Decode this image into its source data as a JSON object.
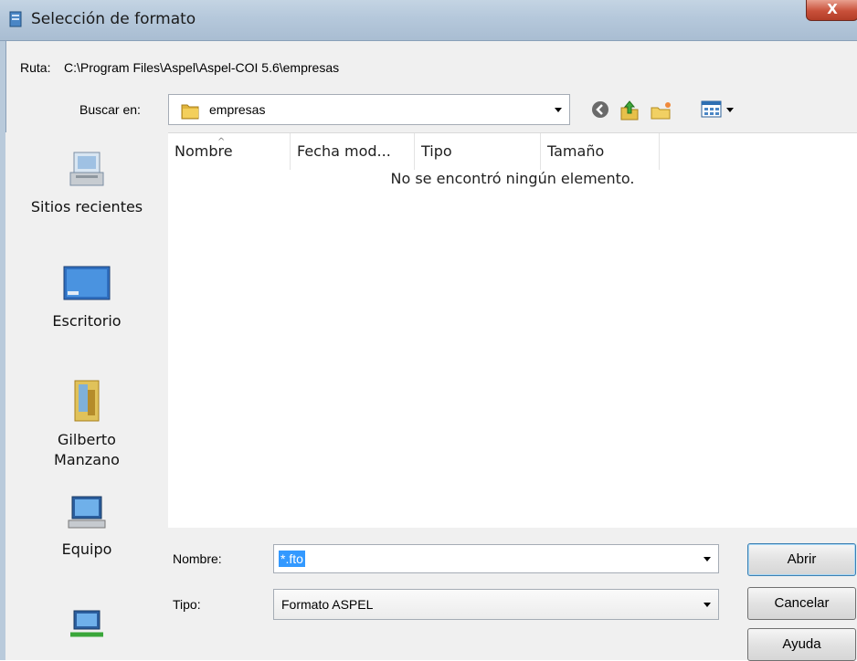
{
  "window": {
    "title": "Selección de formato",
    "close_glyph": "X"
  },
  "path": {
    "label": "Ruta:",
    "value": "C:\\Program Files\\Aspel\\Aspel-COI 5.6\\empresas"
  },
  "look_in": {
    "label": "Buscar en:",
    "value": "empresas",
    "icon": "folder-icon"
  },
  "toolbar": {
    "icons": [
      "back-icon",
      "up-folder-icon",
      "new-folder-icon",
      "view-menu-icon"
    ]
  },
  "places": [
    {
      "label": "Sitios recientes",
      "icon": "recent-places-icon"
    },
    {
      "label": "Escritorio",
      "icon": "desktop-icon"
    },
    {
      "label": "Gilberto Manzano",
      "icon": "user-folder-icon"
    },
    {
      "label": "Equipo",
      "icon": "computer-icon"
    },
    {
      "label": "",
      "icon": "network-icon"
    }
  ],
  "filelist": {
    "columns": [
      "Nombre",
      "Fecha mod...",
      "Tipo",
      "Tamaño"
    ],
    "empty_message": "No se encontró ningún elemento."
  },
  "filename": {
    "label": "Nombre:",
    "value": "*.fto"
  },
  "filetype": {
    "label": "Tipo:",
    "value": "Formato ASPEL"
  },
  "buttons": {
    "open": "Abrir",
    "cancel": "Cancelar",
    "help": "Ayuda"
  },
  "colors": {
    "titlebar": "#b5c8db",
    "close": "#c8503a",
    "selection": "#3399ff"
  }
}
